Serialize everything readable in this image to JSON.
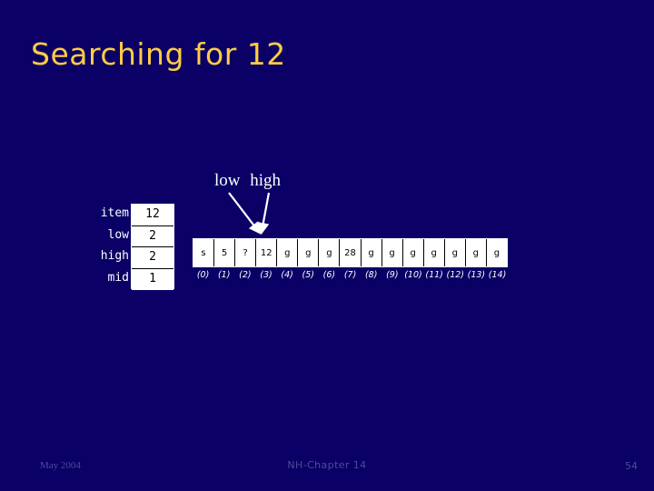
{
  "slide": {
    "title": "Searching for 12",
    "background_color": "#0A0066",
    "title_color": "#FFCC44"
  },
  "variables": {
    "rows": [
      {
        "label": "item",
        "value": "12"
      },
      {
        "label": "low",
        "value": "2"
      },
      {
        "label": "high",
        "value": "2"
      },
      {
        "label": "mid",
        "value": "1"
      }
    ]
  },
  "pointers": {
    "low_label": "low",
    "high_label": "high",
    "low_target_index": 2,
    "high_target_index": 2
  },
  "array": {
    "cells": [
      "s",
      "5",
      "?",
      "12",
      "g",
      "g",
      "g",
      "28",
      "g",
      "g",
      "g",
      "g",
      "g",
      "g",
      "g"
    ],
    "indices": [
      "(0)",
      "(1)",
      "(2)",
      "(3)",
      "(4)",
      "(5)",
      "(6)",
      "(7)",
      "(8)",
      "(9)",
      "(10)",
      "(11)",
      "(12)",
      "(13)",
      "(14)"
    ]
  },
  "footer": {
    "date": "May 2004",
    "center": "NH-Chapter 14",
    "page_number": "54",
    "color": "#4C4C96"
  }
}
